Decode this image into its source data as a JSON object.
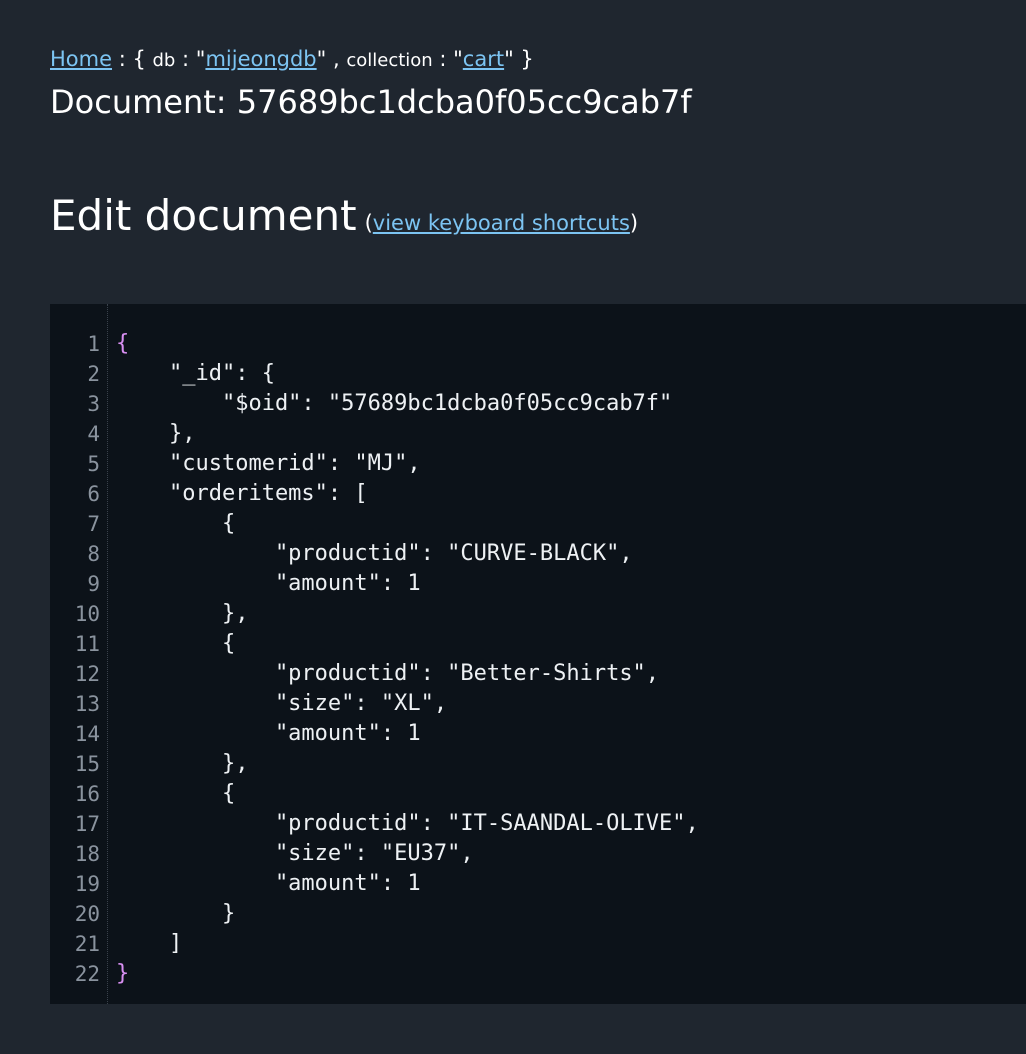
{
  "breadcrumb": {
    "home_label": "Home",
    "sep": " : { ",
    "db_key": "db",
    "db_colon": " : \"",
    "db_value": "mijeongdb",
    "db_close": "\" , ",
    "collection_key": "collection",
    "collection_colon": " : \"",
    "collection_value": "cart",
    "collection_close": "\" }"
  },
  "document": {
    "title": "Document: 57689bc1dcba0f05cc9cab7f"
  },
  "edit": {
    "heading": "Edit document",
    "paren_open": "(",
    "shortcuts_label": "view keyboard shortcuts",
    "paren_close": ")"
  },
  "editor": {
    "lines": [
      "{",
      "    \"_id\": {",
      "        \"$oid\": \"57689bc1dcba0f05cc9cab7f\"",
      "    },",
      "    \"customerid\": \"MJ\",",
      "    \"orderitems\": [",
      "        {",
      "            \"productid\": \"CURVE-BLACK\",",
      "            \"amount\": 1",
      "        },",
      "        {",
      "            \"productid\": \"Better-Shirts\",",
      "            \"size\": \"XL\",",
      "            \"amount\": 1",
      "        },",
      "        {",
      "            \"productid\": \"IT-SAANDAL-OLIVE\",",
      "            \"size\": \"EU37\",",
      "            \"amount\": 1",
      "        }",
      "    ]",
      "}"
    ],
    "colors": {
      "background": "#0c1219",
      "text": "#eef1f4",
      "line_number": "#8a939e",
      "outer_brace": "#d98ff2"
    }
  },
  "theme": {
    "page_background": "#1f262f",
    "link_color": "#7cc4f2"
  }
}
